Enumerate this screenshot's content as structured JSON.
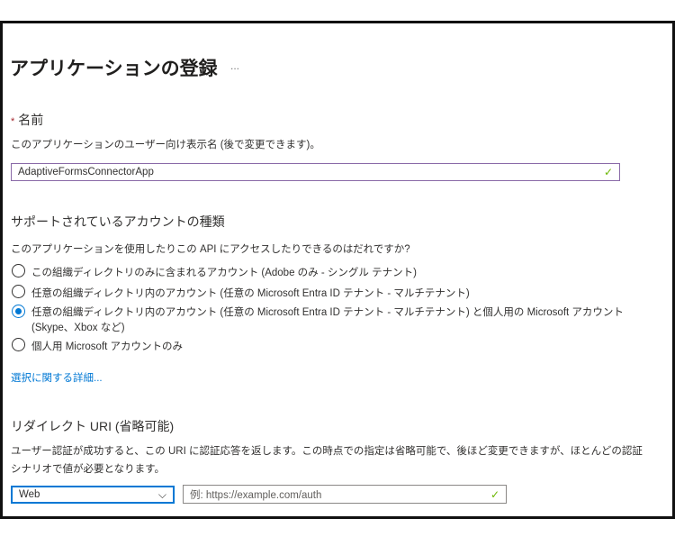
{
  "page": {
    "title": "アプリケーションの登録",
    "more_label": "..."
  },
  "name_section": {
    "required_marker": "*",
    "label": "名前",
    "description": "このアプリケーションのユーザー向け表示名 (後で変更できます)。",
    "value": "AdaptiveFormsConnectorApp"
  },
  "account_section": {
    "heading": "サポートされているアカウントの種類",
    "question": "このアプリケーションを使用したりこの API にアクセスしたりできるのはだれですか?",
    "options": [
      {
        "label": "この組織ディレクトリのみに含まれるアカウント (Adobe のみ - シングル テナント)",
        "selected": false
      },
      {
        "label": "任意の組織ディレクトリ内のアカウント (任意の Microsoft Entra ID テナント - マルチテナント)",
        "selected": false
      },
      {
        "label": "任意の組織ディレクトリ内のアカウント (任意の Microsoft Entra ID テナント - マルチテナント) と個人用の Microsoft アカウント",
        "label_line2": "(Skype、Xbox など)",
        "selected": true
      },
      {
        "label": "個人用 Microsoft アカウントのみ",
        "selected": false
      }
    ],
    "help_link": "選択に関する詳細..."
  },
  "redirect_section": {
    "heading": "リダイレクト URI (省略可能)",
    "description_line1": "ユーザー認証が成功すると、この URI に認証応答を返します。この時点での指定は省略可能で、後ほど変更できますが、ほとんどの認証",
    "description_line2": "シナリオで値が必要となります。",
    "platform_value": "Web",
    "uri_placeholder": "例: https://example.com/auth"
  },
  "colors": {
    "accent": "#0078d4",
    "valid": "#6bb700",
    "required": "#a4262c",
    "focus": "#8a6aa8"
  }
}
